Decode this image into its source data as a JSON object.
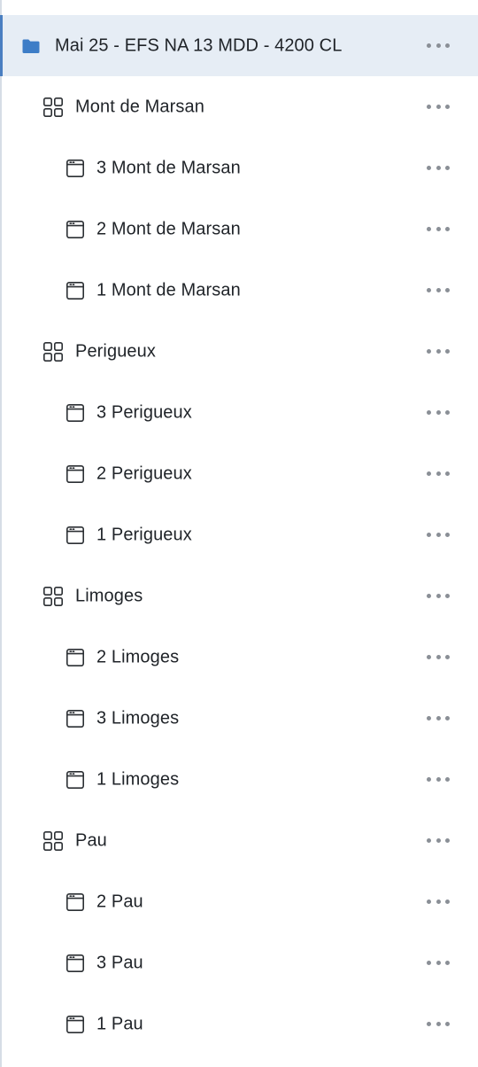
{
  "colors": {
    "folder_icon": "#3d7dc7",
    "selected_row_bg": "#e6edf5",
    "selected_row_accent": "#4a7fc1",
    "text": "#1f2328",
    "more_dots": "#8a8f96"
  },
  "tree": {
    "folder": {
      "label": "Mai 25 - EFS NA 13 MDD - 4200 CL",
      "icon": "folder-icon"
    },
    "groups": [
      {
        "label": "Mont de Marsan",
        "icon": "grid-icon",
        "pages": [
          "3 Mont de Marsan",
          "2 Mont de Marsan",
          "1 Mont de Marsan"
        ]
      },
      {
        "label": "Perigueux",
        "icon": "grid-icon",
        "pages": [
          "3 Perigueux",
          "2 Perigueux",
          "1 Perigueux"
        ]
      },
      {
        "label": "Limoges",
        "icon": "grid-icon",
        "pages": [
          "2 Limoges",
          "3 Limoges",
          "1 Limoges"
        ]
      },
      {
        "label": "Pau",
        "icon": "grid-icon",
        "pages": [
          "2 Pau",
          "3 Pau",
          "1 Pau"
        ]
      }
    ]
  }
}
